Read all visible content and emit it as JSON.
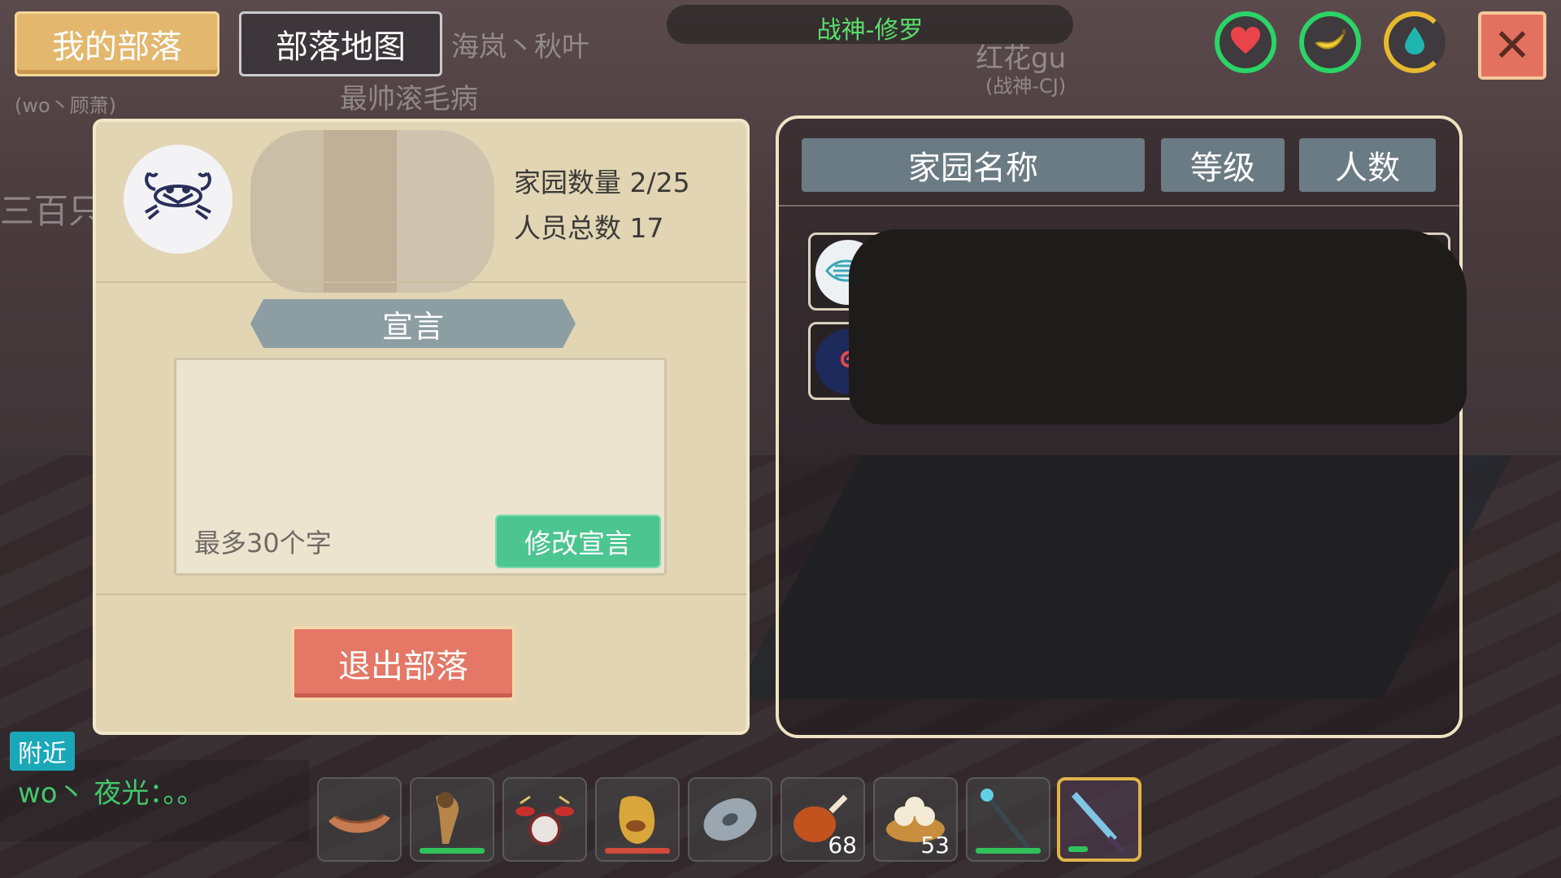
{
  "tabs": {
    "my_tribe": "我的部落",
    "tribe_map": "部落地图"
  },
  "player": {
    "name": "战神-修罗"
  },
  "status": {
    "health_icon": "heart-icon",
    "hunger_icon": "banana-icon",
    "water_icon": "water-drop-icon"
  },
  "tribe": {
    "home_count_label": "家园数量 2/25",
    "member_total_label": "人员总数 17",
    "declaration_title": "宣言",
    "declaration_placeholder": "最多30个字",
    "edit_declaration_button": "修改宣言",
    "exit_button": "退出部落"
  },
  "home_list": {
    "headers": {
      "name": "家园名称",
      "level": "等级",
      "members": "人数"
    }
  },
  "chat": {
    "channel_tag": "附近",
    "last_message": "wo丶 夜光：。。"
  },
  "background_labels": [
    "海岚丶秋叶",
    "最帅滚毛病",
    "红花gu",
    "(战神-CJ)",
    "(wo丶顾萧)",
    "三百只"
  ],
  "hotbar": [
    {
      "item": "wooden-boat-icon",
      "count": ""
    },
    {
      "item": "torch-horn-icon",
      "count": ""
    },
    {
      "item": "drum-set-icon",
      "count": ""
    },
    {
      "item": "banana-pouch-icon",
      "count": ""
    },
    {
      "item": "disc-icon",
      "count": ""
    },
    {
      "item": "roast-drumstick-icon",
      "count": "68"
    },
    {
      "item": "dumplings-icon",
      "count": "53"
    },
    {
      "item": "magic-staff-icon",
      "count": ""
    },
    {
      "item": "crystal-blade-icon",
      "count": ""
    }
  ],
  "colors": {
    "accent_gold": "#e3b76d",
    "edit_green": "#4dc590",
    "exit_red": "#e47766",
    "player_green": "#59e06a"
  }
}
